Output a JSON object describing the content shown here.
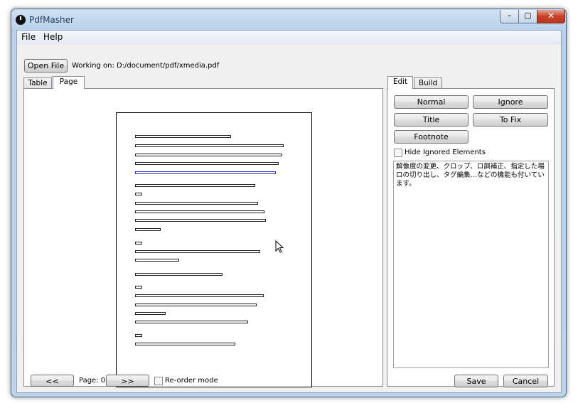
{
  "window": {
    "title": "PdfMasher"
  },
  "menu": {
    "items": [
      "File",
      "Help"
    ]
  },
  "toolbar": {
    "open_file_label": "Open File",
    "working_on_label": "Working on: D:/document/pdf/xmedia.pdf"
  },
  "left_tabs": [
    "Table",
    "Page"
  ],
  "left_active_tab": "Page",
  "page_nav": {
    "prev_label": "<<",
    "page_label": "Page: 0",
    "next_label": ">>",
    "reorder_label": "Re-order mode",
    "reorder_checked": false
  },
  "right_tabs": [
    "Edit",
    "Build"
  ],
  "right_active_tab": "Edit",
  "edit": {
    "normal_label": "Normal",
    "ignore_label": "Ignore",
    "title_label": "Title",
    "tofix_label": "To Fix",
    "footnote_label": "Footnote",
    "hide_ignored_label": "Hide Ignored Elements",
    "hide_ignored_checked": false,
    "text": "解像度の変更、クロップ、ロ調補正、指定した場ロの切り出し、タグ編集…などの機能も付いています。"
  },
  "footer": {
    "save_label": "Save",
    "cancel_label": "Cancel"
  }
}
